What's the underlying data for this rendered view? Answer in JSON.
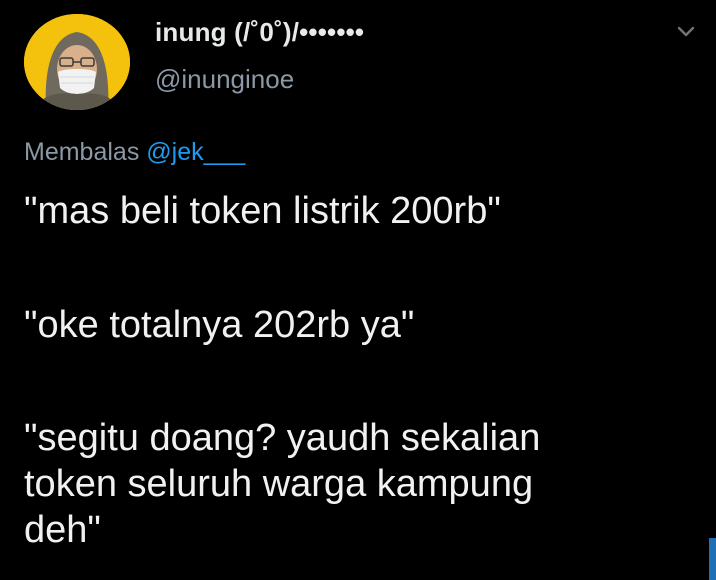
{
  "tweet": {
    "display_name": "inung (/˚0˚)/•••••••",
    "handle": "@inunginoe",
    "reply_prefix": "Membalas",
    "reply_mention": "@jek___",
    "paragraphs": [
      {
        "lines": [
          "\"mas beli token listrik 200rb\""
        ]
      },
      {
        "lines": [
          "\"oke totalnya 202rb ya\""
        ]
      },
      {
        "lines": [
          "\"segitu doang? yaudh sekalian",
          "token seluruh warga kampung",
          "deh\""
        ]
      }
    ],
    "icons": {
      "avatar": "profile-avatar",
      "menu": "chevron-down-icon"
    }
  },
  "colors": {
    "background": "#000000",
    "primary_text": "#e7e9ea",
    "secondary_text": "#8b98a5",
    "mention": "#1d9bf0",
    "avatar_bg": "#f4c20d"
  }
}
